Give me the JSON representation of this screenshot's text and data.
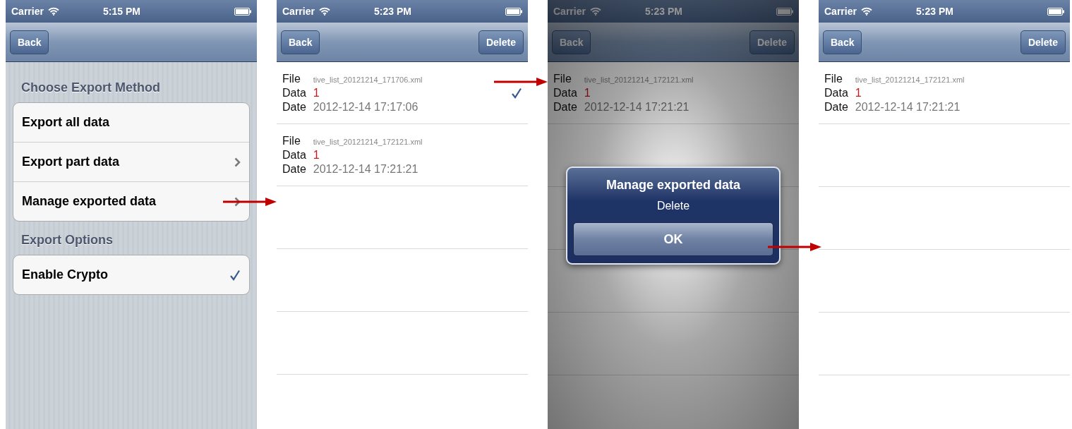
{
  "screens": [
    {
      "kind": "settings",
      "status_bar": {
        "carrier": "Carrier",
        "time": "5:15 PM"
      },
      "nav_bar": {
        "left_button": "Back"
      },
      "sections": [
        {
          "header": "Choose Export Method",
          "rows": [
            {
              "label": "Export all data",
              "kind": "action"
            },
            {
              "label": "Export part data",
              "kind": "disclosure"
            },
            {
              "label": "Manage exported data",
              "kind": "disclosure"
            }
          ]
        },
        {
          "header": "Export Options",
          "rows": [
            {
              "label": "Enable Crypto",
              "kind": "option",
              "checked": true
            }
          ]
        }
      ]
    },
    {
      "kind": "files",
      "status_bar": {
        "carrier": "Carrier",
        "time": "5:23 PM"
      },
      "nav_bar": {
        "left_button": "Back",
        "right_button": "Delete"
      },
      "files": [
        {
          "file_label": "File",
          "file": "tive_list_20121214_171706.xml",
          "data_label": "Data",
          "data": "1",
          "date_label": "Date",
          "date": "2012-12-14 17:17:06",
          "checked": true
        },
        {
          "file_label": "File",
          "file": "tive_list_20121214_172121.xml",
          "data_label": "Data",
          "data": "1",
          "date_label": "Date",
          "date": "2012-12-14 17:21:21",
          "checked": false
        }
      ]
    },
    {
      "kind": "alert",
      "status_bar": {
        "carrier": "Carrier",
        "time": "5:23 PM"
      },
      "nav_bar": {
        "left_button": "Back",
        "right_button": "Delete"
      },
      "files": [
        {
          "file_label": "File",
          "file": "tive_list_20121214_172121.xml",
          "data_label": "Data",
          "data": "1",
          "date_label": "Date",
          "date": "2012-12-14 17:21:21",
          "checked": false
        }
      ],
      "alert": {
        "title": "Manage exported data",
        "message": "Delete",
        "button": "OK"
      }
    },
    {
      "kind": "files",
      "status_bar": {
        "carrier": "Carrier",
        "time": "5:23 PM"
      },
      "nav_bar": {
        "left_button": "Back",
        "right_button": "Delete"
      },
      "files": [
        {
          "file_label": "File",
          "file": "tive_list_20121214_172121.xml",
          "data_label": "Data",
          "data": "1",
          "date_label": "Date",
          "date": "2012-12-14 17:21:21",
          "checked": false
        }
      ]
    }
  ]
}
